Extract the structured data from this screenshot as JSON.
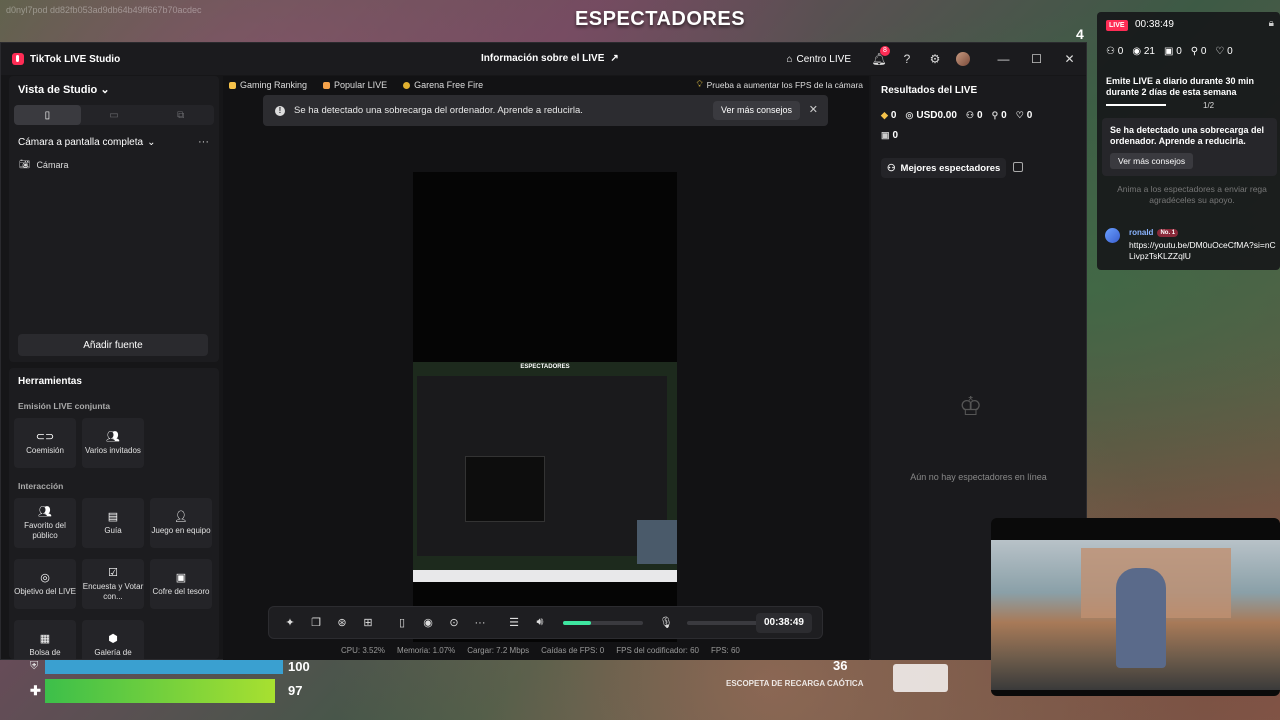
{
  "game": {
    "stream_id": "d0nyl7pod    dd82fb053ad9db64b49ff667b70acdec",
    "title": "ESPECTADORES",
    "corner_number": "4",
    "hud": {
      "shield_value": "100",
      "health_value": "97",
      "ammo": "36",
      "weapon_name": "ESCOPETA DE RECARGA CAÓTICA"
    }
  },
  "studio": {
    "app_title": "TikTok LIVE Studio",
    "live_info": "Información sobre el LIVE",
    "centro_live": "Centro LIVE",
    "notif_count": "8",
    "left": {
      "view_label": "Vista de Studio",
      "scene_label": "Cámara a pantalla completa",
      "source_camera": "Cámara",
      "add_source": "Añadir fuente"
    },
    "tools": {
      "heading": "Herramientas",
      "section_joint": "Emisión LIVE conjunta",
      "section_interaction": "Interacción",
      "tiles": {
        "comision": "Coemisión",
        "varios": "Varios invitados",
        "favorito": "Favorito del público",
        "guia": "Guía",
        "juego": "Juego en equipo",
        "objetivo": "Objetivo del LIVE",
        "encuesta": "Encuesta y Votar con...",
        "cofre": "Cofre del tesoro",
        "bolsa": "Bolsa de",
        "galeria": "Galería de"
      }
    },
    "tags": {
      "gaming": "Gaming Ranking",
      "popular": "Popular LIVE",
      "garena": "Garena Free Fire",
      "fps_tip": "Prueba a aumentar los FPS de la cámara"
    },
    "alert": {
      "message": "Se ha detectado una sobrecarga del ordenador. Aprende a reducirla.",
      "more_button": "Ver más consejos"
    },
    "preview": {
      "nested_title": "ESPECTADORES"
    },
    "controls": {
      "timer": "00:38:49",
      "volume_level_pct": 35
    },
    "stats": {
      "cpu": "CPU: 3.52%",
      "memory": "Memoria: 1.07%",
      "upload": "Cargar: 7.2 Mbps",
      "fps_drops": "Caídas de FPS: 0",
      "encoder_fps": "FPS del codificador: 60",
      "fps": "FPS: 60"
    },
    "results": {
      "heading": "Resultados del LIVE",
      "diamonds": "0",
      "usd": "USD0.00",
      "viewers": "0",
      "new_followers": "0",
      "likes": "0",
      "gifts": "0",
      "best_viewers": "Mejores espectadores",
      "empty": "Aún no hay espectadores en línea"
    }
  },
  "overlay": {
    "live_badge": "LIVE",
    "time": "00:38:49",
    "stats": {
      "followers": "0",
      "views": "21",
      "gifts": "0",
      "shares": "0",
      "likes": "0"
    },
    "goal_text": "Emite LIVE a diario durante 30 min durante 2 días de esta semana",
    "goal_fraction": "1/2",
    "alert_text": "Se ha detectado una sobrecarga del ordenador. Aprende a reducirla.",
    "alert_button": "Ver más consejos",
    "hint": "Anima a los espectadores a enviar rega agradéceles su apoyo.",
    "message": {
      "user": "ronald",
      "rank": "No. 1",
      "text": "https://youtu.be/DM0uOceCfMA?si=nCLivpzTsKLZZqlU"
    }
  }
}
